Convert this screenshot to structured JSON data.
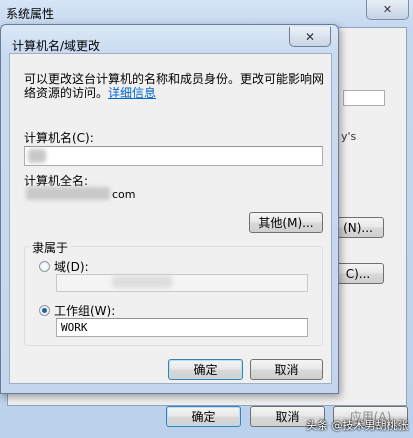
{
  "background_window": {
    "title": "系统属性",
    "close_glyph": "✕",
    "tab_fragments": [
      "",
      "",
      ""
    ],
    "side_fragment_1": "y's",
    "side_button_1": "(N)...",
    "side_button_2": "C)...",
    "buttons": {
      "ok": "确定",
      "cancel": "取消",
      "apply": "应用(A)"
    }
  },
  "dialog": {
    "title": "计算机名/域更改",
    "close_glyph": "✕",
    "description_line1": "可以更改这台计算机的名称和成员身份。更改可能影响网",
    "description_line2": "络资源的访问。",
    "details_link": "详细信息",
    "computer_name_label": "计算机名(C):",
    "computer_name_value": "",
    "full_name_label": "计算机全名:",
    "full_name_suffix": "com",
    "other_button": "其他(M)...",
    "member_of_label": "隶属于",
    "domain_option": "域(D):",
    "domain_value": "",
    "workgroup_option": "工作组(W):",
    "workgroup_value": "WORK",
    "selected_option": "workgroup",
    "ok_button": "确定",
    "cancel_button": "取消"
  },
  "watermark": {
    "text": "头条 @技术男胡桃张"
  }
}
